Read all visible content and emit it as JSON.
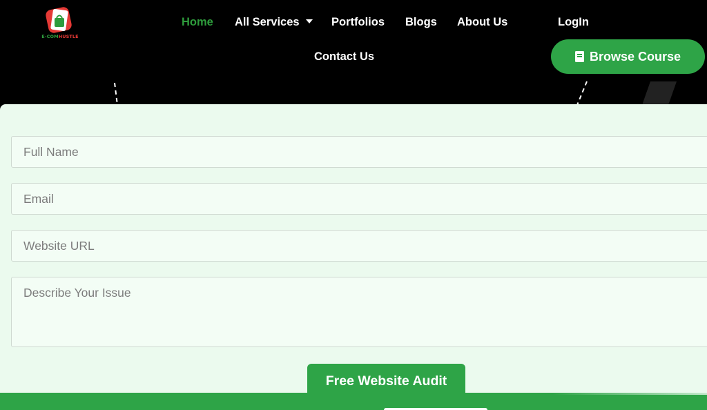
{
  "brand": {
    "logo_text_part1": "E-COM",
    "logo_text_part2": "HUSTLE",
    "colors": {
      "green": "#2ea447",
      "red": "#e53935",
      "background": "#000000",
      "panel": "#ebfaee"
    }
  },
  "nav": {
    "home": "Home",
    "all_services": "All Services",
    "portfolios": "Portfolios",
    "blogs": "Blogs",
    "about_us": "About Us",
    "login": "LogIn",
    "contact_us": "Contact Us",
    "browse_course": "Browse Course",
    "browse_course_icon": "book-icon",
    "services_icon": "caret-down-icon"
  },
  "form": {
    "full_name_placeholder": "Full Name",
    "email_placeholder": "Email",
    "website_url_placeholder": "Website URL",
    "issue_placeholder": "Describe Your Issue",
    "submit_label": "Free Website Audit"
  }
}
